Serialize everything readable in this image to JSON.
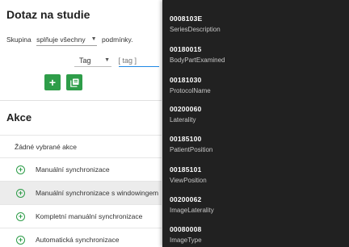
{
  "panel": {
    "title": "Dotaz na studie",
    "group_label": "Skupina",
    "group_select": "splňuje všechny",
    "group_tail": "podmínky.",
    "tag_select": "Tag",
    "tag_input_placeholder": "[ tag ]",
    "add_icon_glyph": "+",
    "actions_title": "Akce",
    "actions_empty": "Žádné vybrané akce",
    "plus_glyph": "+",
    "actions": [
      "Manuální synchronizace",
      "Manuální synchronizace s windowingem",
      "Kompletní manuální synchronizace",
      "Automatická synchronizace"
    ],
    "accent_color": "#2e9d49"
  },
  "dropdown": {
    "items": [
      {
        "code": "0008103E",
        "name": "SeriesDescription"
      },
      {
        "code": "00180015",
        "name": "BodyPartExamined"
      },
      {
        "code": "00181030",
        "name": "ProtocolName"
      },
      {
        "code": "00200060",
        "name": "Laterality"
      },
      {
        "code": "00185100",
        "name": "PatientPosition"
      },
      {
        "code": "00185101",
        "name": "ViewPosition"
      },
      {
        "code": "00200062",
        "name": "ImageLaterality"
      },
      {
        "code": "00080008",
        "name": "ImageType"
      }
    ]
  }
}
